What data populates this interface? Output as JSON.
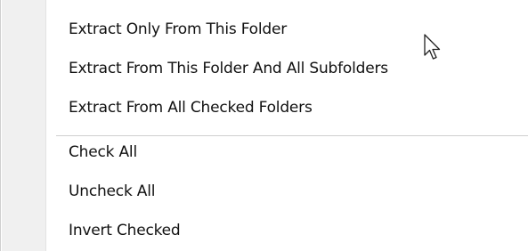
{
  "menu": {
    "items": [
      {
        "label": "Extract Only From This Folder"
      },
      {
        "label": "Extract From This Folder And All Subfolders"
      },
      {
        "label": "Extract From All Checked Folders"
      },
      {
        "label": "Check All"
      },
      {
        "label": "Uncheck All"
      },
      {
        "label": "Invert Checked"
      }
    ]
  },
  "colors": {
    "background": "#ffffff",
    "gutter": "#f0f0f0",
    "text": "#111111",
    "separator": "#cfcfcf"
  },
  "icons": [
    "mouse-pointer-icon"
  ]
}
